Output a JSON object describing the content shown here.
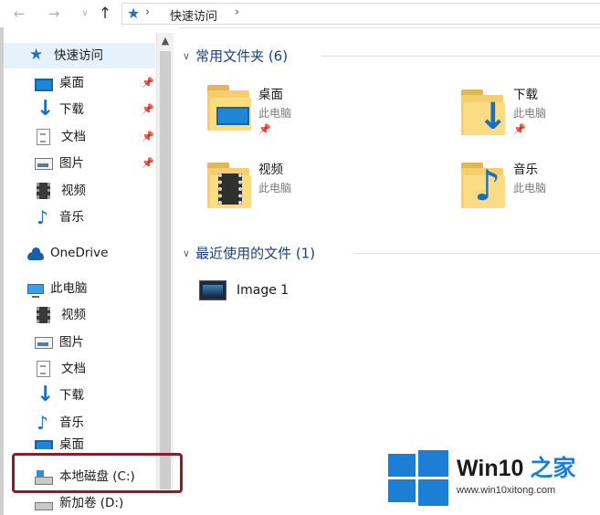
{
  "address_bar": {
    "back_icon": "back-arrow-icon",
    "forward_icon": "forward-arrow-icon",
    "recent_icon": "chevron-down-icon",
    "up_icon": "up-arrow-icon",
    "crumb": "快速访问"
  },
  "sidebar": {
    "quick_access": "快速访问",
    "quick_items": [
      {
        "label": "桌面",
        "icon": "desktop-icon",
        "pinned": true
      },
      {
        "label": "下载",
        "icon": "download-icon",
        "pinned": true
      },
      {
        "label": "文档",
        "icon": "document-icon",
        "pinned": true
      },
      {
        "label": "图片",
        "icon": "picture-icon",
        "pinned": true
      },
      {
        "label": "视频",
        "icon": "video-icon",
        "pinned": false
      },
      {
        "label": "音乐",
        "icon": "music-icon",
        "pinned": false
      }
    ],
    "onedrive": "OneDrive",
    "this_pc": "此电脑",
    "pc_items": [
      {
        "label": "视频",
        "icon": "video-icon"
      },
      {
        "label": "图片",
        "icon": "picture-icon"
      },
      {
        "label": "文档",
        "icon": "document-icon"
      },
      {
        "label": "下载",
        "icon": "download-icon"
      },
      {
        "label": "音乐",
        "icon": "music-icon"
      },
      {
        "label": "桌面",
        "icon": "desktop-icon"
      }
    ],
    "local_disk": "本地磁盘 (C:)",
    "new_volume": "新加卷 (D:)"
  },
  "content": {
    "frequent_header": "常用文件夹 (6)",
    "folders": [
      {
        "name": "桌面",
        "location": "此电脑",
        "pinned": true,
        "icon": "desktop-folder-icon"
      },
      {
        "name": "下载",
        "location": "此电脑",
        "pinned": true,
        "icon": "download-folder-icon"
      },
      {
        "name": "视频",
        "location": "此电脑",
        "pinned": false,
        "icon": "video-folder-icon"
      },
      {
        "name": "音乐",
        "location": "此电脑",
        "pinned": false,
        "icon": "music-folder-icon"
      }
    ],
    "recent_header": "最近使用的文件 (1)",
    "recent_files": [
      {
        "name": "Image 1",
        "icon": "image-file-icon"
      }
    ]
  },
  "watermark": {
    "brand": "Win10",
    "brand_suffix": "之家",
    "url": "www.win10xitong.com"
  },
  "colors": {
    "accent": "#1d7fd4",
    "selection": "#e5f1fb",
    "callout": "#8e1b2c",
    "header_text": "#1f3f7a"
  }
}
